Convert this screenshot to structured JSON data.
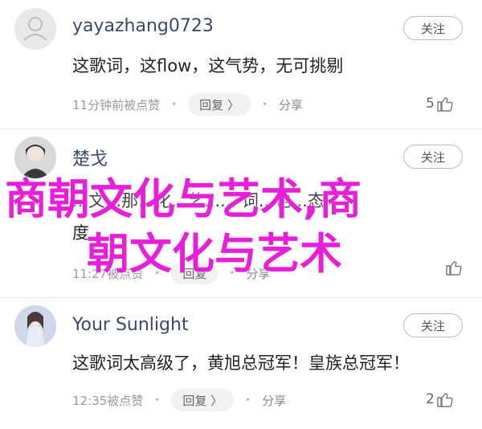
{
  "colors": {
    "username": "#3b4a6b",
    "overlay": "#e81fd9",
    "reply_bg": "#f2f2f2",
    "follow_border": "#b9bdc7"
  },
  "comments": [
    {
      "username": "yayazhang0723",
      "follow": "关注",
      "text": "这歌词，这flow，这气势，无可挑剔",
      "time": "11分钟前被点赞",
      "reply": "回复 〉",
      "share": "分享",
      "likes": "5",
      "avatar_icon": "default-avatar-icon"
    },
    {
      "username": "楚戈",
      "follow": "关注",
      "text_line1": "...文...那...化...艺...... 词...也...态",
      "text_line2": "度",
      "time": "11:27被点赞",
      "reply": "回复",
      "share": "分享",
      "likes": "",
      "avatar_icon": "photo-avatar-icon"
    },
    {
      "username": "Your Sunlight",
      "follow": "关注",
      "text": "这歌词太高级了，黄旭总冠军！皇族总冠军！",
      "time": "12:35被点赞",
      "reply": "回复 〉",
      "share": "分享",
      "likes": "2",
      "avatar_icon": "photo-avatar-icon"
    }
  ],
  "overlay": {
    "line1": "商朝文化与艺术,商",
    "line2": "朝文化与艺术"
  }
}
